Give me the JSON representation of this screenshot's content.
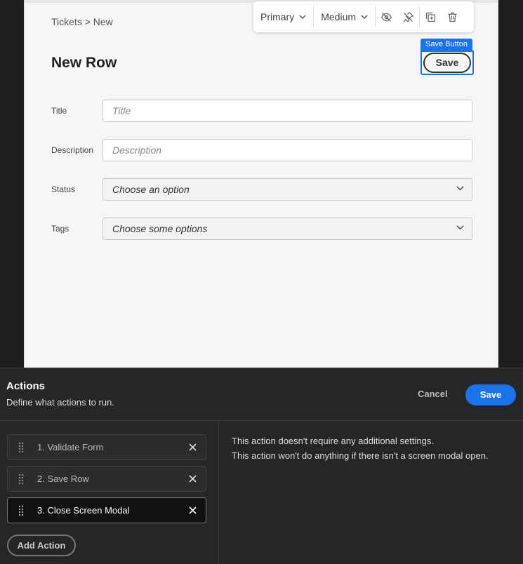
{
  "preview": {
    "breadcrumb": "Tickets > New",
    "title": "New Row",
    "save_tag": "Save Button",
    "save_label": "Save",
    "toolbar": {
      "type_value": "Primary",
      "size_value": "Medium",
      "icons": [
        "eye-off-icon",
        "pin-off-icon",
        "duplicate-icon",
        "trash-icon"
      ]
    },
    "fields": [
      {
        "label": "Title",
        "placeholder": "Title"
      },
      {
        "label": "Description",
        "placeholder": "Description"
      },
      {
        "label": "Status",
        "placeholder": "Choose an option"
      },
      {
        "label": "Tags",
        "placeholder": "Choose some options"
      }
    ]
  },
  "actions": {
    "title": "Actions",
    "subtitle": "Define what actions to run.",
    "cancel_label": "Cancel",
    "save_label": "Save",
    "items": [
      {
        "label": "1. Validate Form"
      },
      {
        "label": "2. Save Row"
      },
      {
        "label": "3. Close Screen Modal"
      }
    ],
    "add_label": "Add Action",
    "info": [
      "This action doesn't require any additional settings.",
      "This action won't do anything if there isn't a screen modal open."
    ],
    "accent": "#1a73e8"
  }
}
